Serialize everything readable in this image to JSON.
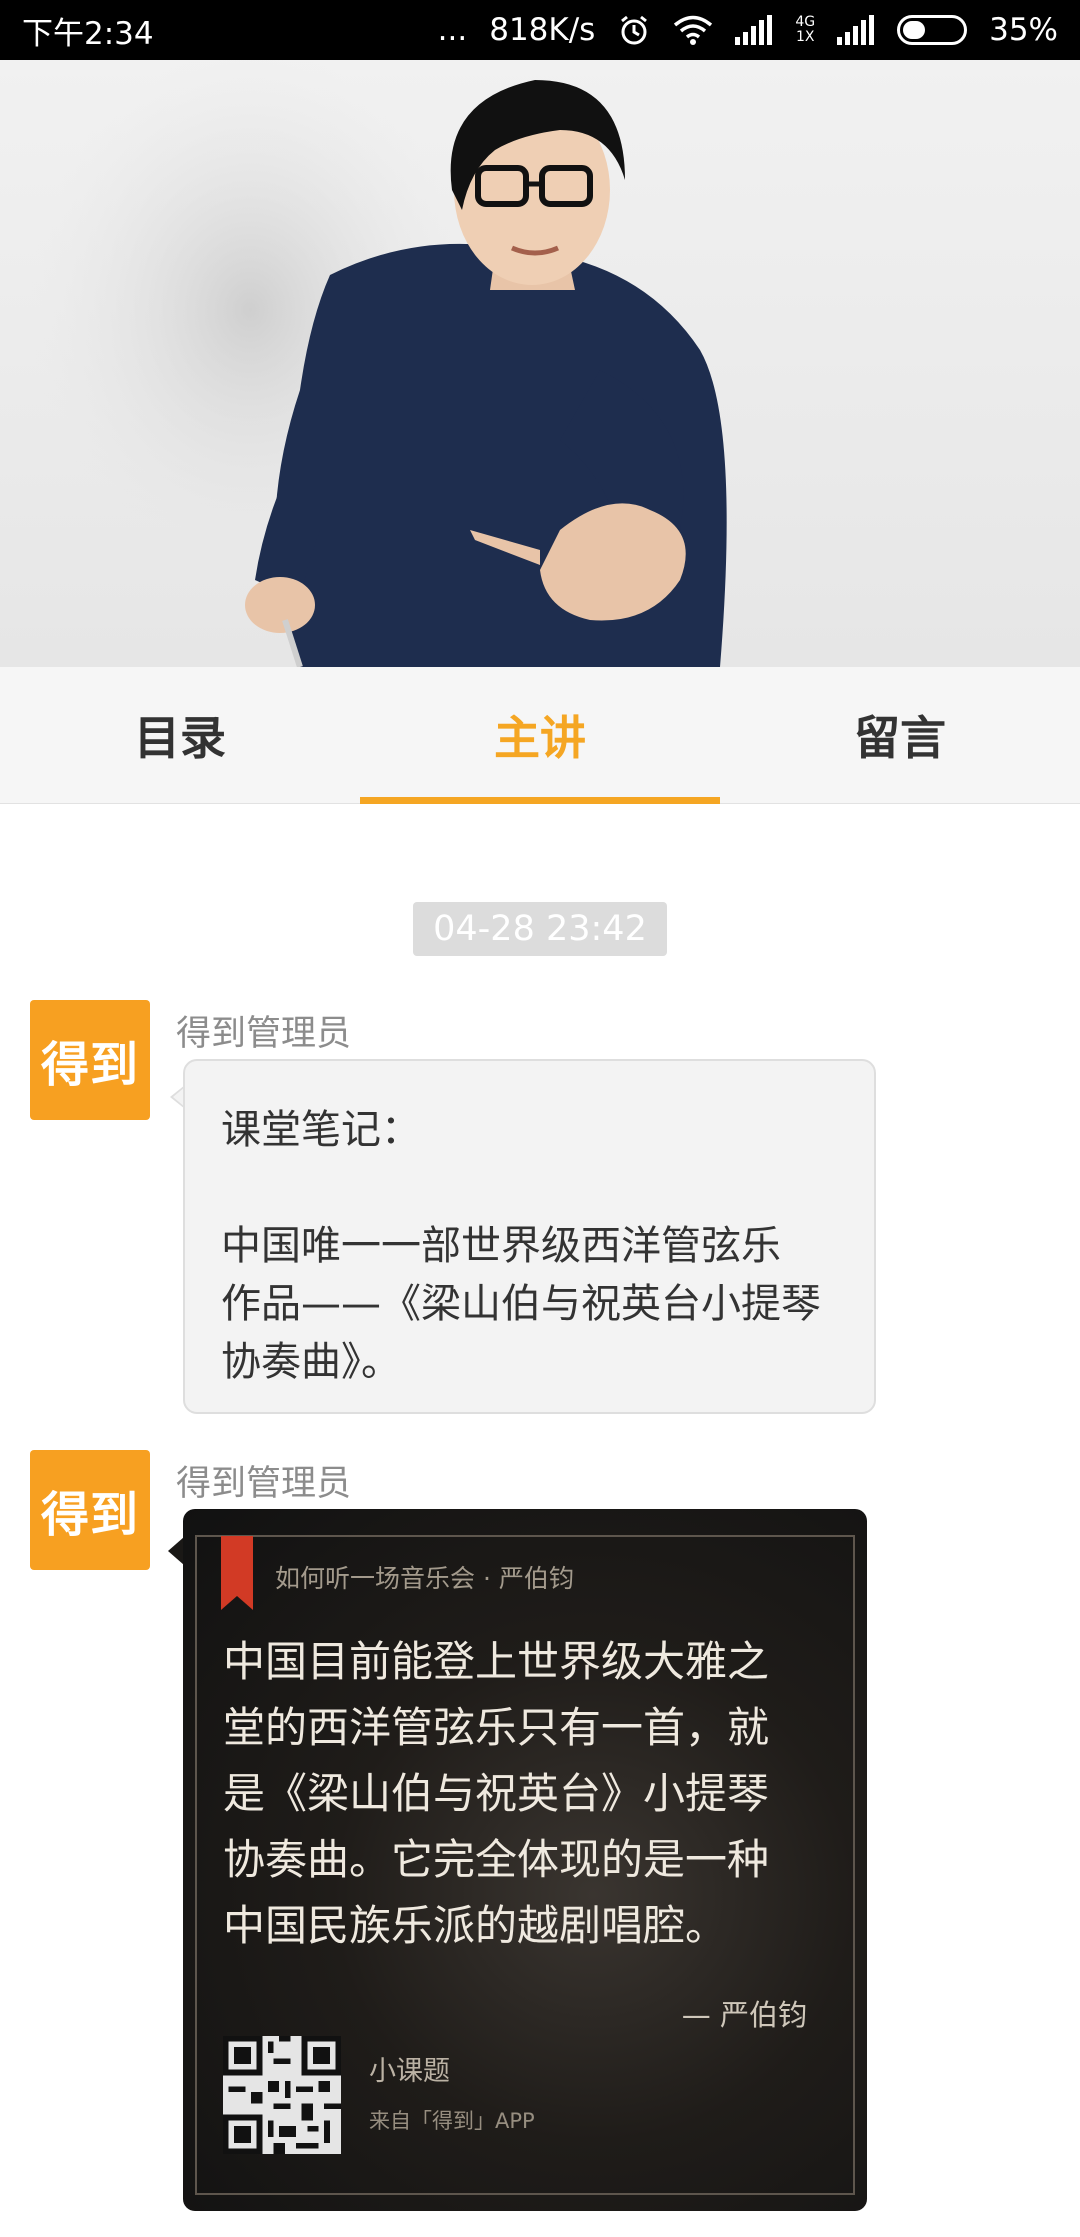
{
  "status_bar": {
    "time": "下午2:34",
    "dots": "...",
    "speed": "818K/s",
    "network_label_top": "4G",
    "network_label_bottom": "1X",
    "battery": "35%"
  },
  "tabs": [
    {
      "label": "目录",
      "active": false
    },
    {
      "label": "主讲",
      "active": true
    },
    {
      "label": "留言",
      "active": false
    }
  ],
  "messages": {
    "time_badge": "04-28 23:42",
    "avatar_text": "得到",
    "msg1": {
      "sender": "得到管理员",
      "line1": "课堂笔记：",
      "line2": "中国唯一一部世界级西洋管弦乐",
      "line3": "作品——《梁山伯与祝英台小提琴",
      "line4": "协奏曲》。"
    },
    "msg2": {
      "sender": "得到管理员",
      "card_source": "如何听一场音乐会 · 严伯钧",
      "quote_line1": "中国目前能登上世界级大雅之",
      "quote_line2": "堂的西洋管弦乐只有一首，就",
      "quote_line3": "是《梁山伯与祝英台》小提琴",
      "quote_line4": "协奏曲。它完全体现的是一种",
      "quote_line5": "中国民族乐派的越剧唱腔。",
      "author": "— 严伯钧",
      "mini_title": "小课题",
      "mini_sub": "来自「得到」APP"
    }
  },
  "colors": {
    "accent": "#f5a623",
    "avatar_bg": "#f7a021",
    "bookmark": "#d23a25"
  }
}
